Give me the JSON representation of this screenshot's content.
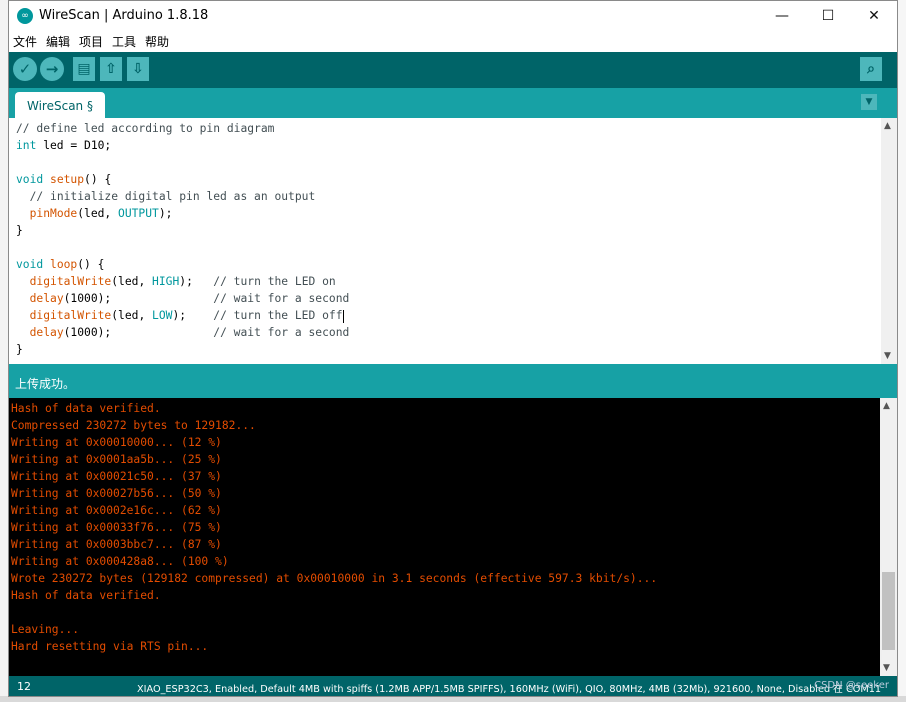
{
  "window": {
    "title": "WireScan | Arduino 1.8.18",
    "app_logo_icon": "arduino-infinity-icon",
    "minimize": "—",
    "maximize": "☐",
    "close": "✕"
  },
  "menu": [
    "文件",
    "编辑",
    "项目",
    "工具",
    "帮助"
  ],
  "toolbar": {
    "icons": [
      "verify-check-icon",
      "upload-arrow-icon",
      "new-file-icon",
      "open-up-arrow-icon",
      "save-down-arrow-icon",
      "serial-monitor-icon"
    ],
    "glyphs": {
      "verify": "✓",
      "upload": "→",
      "new": "▤",
      "open": "⇧",
      "save": "⇩",
      "monitor": "⌕"
    }
  },
  "tab": {
    "label": "WireScan §",
    "menu_glyph": "▼"
  },
  "editor": {
    "lines": [
      "// define led according to pin diagram",
      "int led = D10;",
      "",
      "void setup() {",
      "  // initialize digital pin led as an output",
      "  pinMode(led, OUTPUT);",
      "}",
      "",
      "void loop() {",
      "  digitalWrite(led, HIGH);   // turn the LED on",
      "  delay(1000);               // wait for a second",
      "  digitalWrite(led, LOW);    // turn the LED off",
      "  delay(1000);               // wait for a second",
      "}"
    ],
    "cursor_line": 11
  },
  "status": {
    "message": "上传成功。"
  },
  "console": {
    "lines": [
      "Hash of data verified.",
      "Compressed 230272 bytes to 129182...",
      "Writing at 0x00010000... (12 %)",
      "Writing at 0x0001aa5b... (25 %)",
      "Writing at 0x00021c50... (37 %)",
      "Writing at 0x00027b56... (50 %)",
      "Writing at 0x0002e16c... (62 %)",
      "Writing at 0x00033f76... (75 %)",
      "Writing at 0x0003bbc7... (87 %)",
      "Writing at 0x000428a8... (100 %)",
      "Wrote 230272 bytes (129182 compressed) at 0x00010000 in 3.1 seconds (effective 597.3 kbit/s)...",
      "Hash of data verified.",
      "",
      "Leaving...",
      "Hard resetting via RTS pin..."
    ]
  },
  "footer": {
    "line_number": "12",
    "board": "XIAO_ESP32C3, Enabled, Default 4MB with spiffs (1.2MB APP/1.5MB SPIFFS), 160MHz (WiFi), QIO, 80MHz, 4MB (32Mb), 921600, None, Disabled 在 COM11",
    "watermark": "CSDN @seeker"
  },
  "colors": {
    "toolbar": "#006468",
    "tabbar": "#17a1a5",
    "button": "#4db7bb",
    "console_text": "#e34c00",
    "comment": "#434f54",
    "keyword": "#00979d",
    "function": "#d35400"
  }
}
